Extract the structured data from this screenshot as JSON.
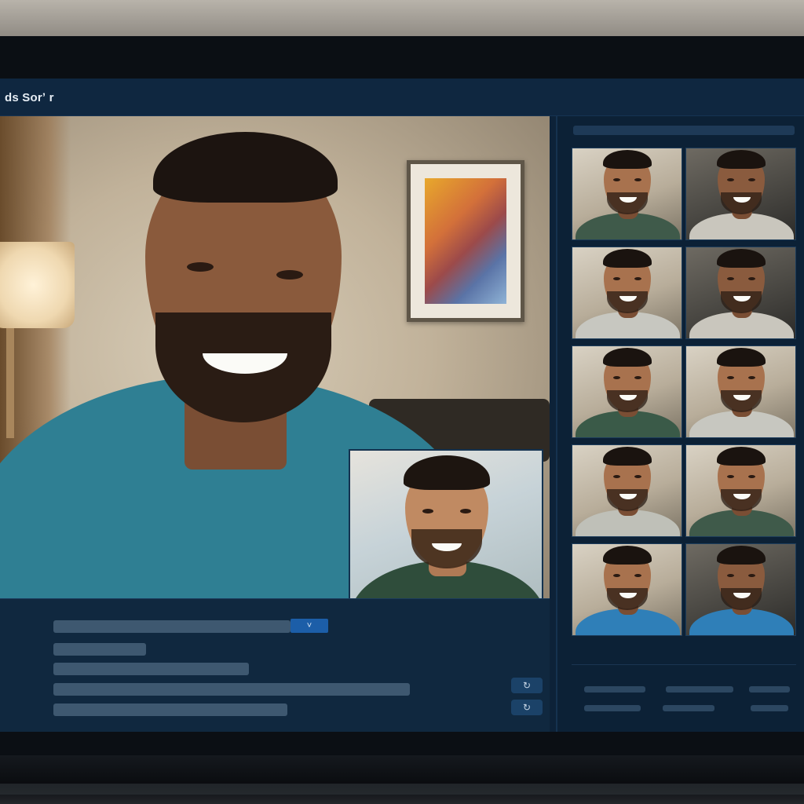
{
  "app": {
    "title": "ds Sorʼ r"
  },
  "right_panel": {
    "header": "",
    "participants": [
      {
        "name": "",
        "tone": "light",
        "shirt": "#3f5a4a"
      },
      {
        "name": "",
        "tone": "dark",
        "shirt": "#c9c6bd"
      },
      {
        "name": "",
        "tone": "light",
        "shirt": "#c7c7c0"
      },
      {
        "name": "",
        "tone": "dark",
        "shirt": "#c9c6bd"
      },
      {
        "name": "",
        "tone": "light",
        "shirt": "#3a5a48"
      },
      {
        "name": "",
        "tone": "light",
        "shirt": "#c7c7c0"
      },
      {
        "name": "",
        "tone": "light",
        "shirt": "#bfc0b8"
      },
      {
        "name": "",
        "tone": "light",
        "shirt": "#3f5a4a"
      },
      {
        "name": "",
        "tone": "light",
        "shirt": "#2f7fb8"
      },
      {
        "name": "",
        "tone": "dark",
        "shirt": "#2f7fb8"
      }
    ],
    "footer": [
      "",
      "",
      "",
      "",
      "",
      ""
    ]
  },
  "controls": {
    "dropdown_value": "",
    "dropdown_icon": "chevron-down-icon",
    "dropdown_glyph": "˅",
    "fields": [
      "",
      "",
      "",
      ""
    ],
    "buttons": [
      {
        "icon": "rotate-icon",
        "glyph": "↻"
      },
      {
        "icon": "refresh-icon",
        "glyph": "↻"
      }
    ]
  },
  "colors": {
    "accent": "#1c5ea8",
    "panel": "#10283f",
    "main_shirt": "#2f7f93"
  }
}
